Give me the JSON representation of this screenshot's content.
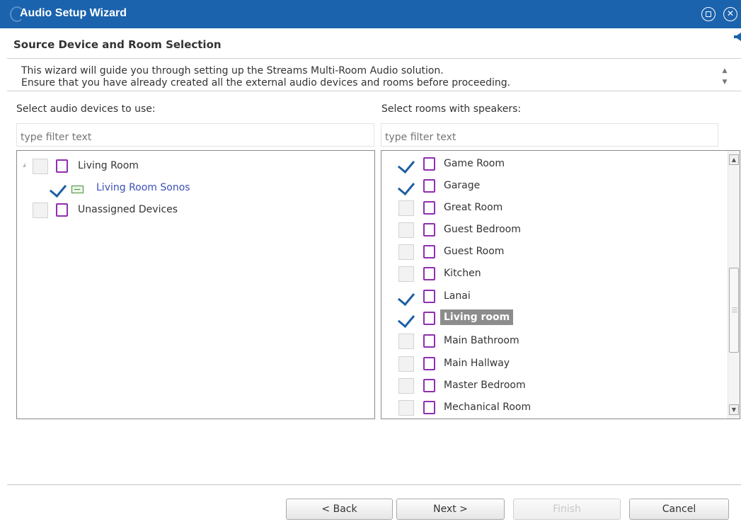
{
  "window": {
    "title": "Audio Setup Wizard",
    "restore_icon": "restore-icon",
    "close_icon": "close-icon"
  },
  "page": {
    "heading": "Source Device and Room Selection",
    "intro_lines": [
      "This wizard will guide you through setting up the Streams Multi-Room Audio solution.",
      "Ensure that you have already created all the external audio devices and rooms before proceeding."
    ]
  },
  "devices_panel": {
    "label": "Select audio devices to use:",
    "filter_placeholder": "type filter text",
    "items": [
      {
        "label": "Living Room",
        "checked": false,
        "type": "room",
        "expanded": true,
        "level": 0
      },
      {
        "label": "Living Room Sonos",
        "checked": true,
        "type": "device",
        "level": 1
      },
      {
        "label": "Unassigned Devices",
        "checked": false,
        "type": "room",
        "level": 0
      }
    ]
  },
  "rooms_panel": {
    "label": "Select rooms with speakers:",
    "filter_placeholder": "type filter text",
    "items": [
      {
        "label": "Game Room",
        "checked": true
      },
      {
        "label": "Garage",
        "checked": true
      },
      {
        "label": "Great Room",
        "checked": false
      },
      {
        "label": "Guest Bedroom",
        "checked": false
      },
      {
        "label": "Guest Room",
        "checked": false
      },
      {
        "label": "Kitchen",
        "checked": false
      },
      {
        "label": "Lanai",
        "checked": true
      },
      {
        "label": "Living room",
        "checked": true,
        "selected": true
      },
      {
        "label": "Main Bathroom",
        "checked": false
      },
      {
        "label": "Main Hallway",
        "checked": false
      },
      {
        "label": "Master Bedroom",
        "checked": false
      },
      {
        "label": "Mechanical Room",
        "checked": false
      }
    ]
  },
  "buttons": {
    "back": "< Back",
    "next": "Next >",
    "finish": "Finish",
    "cancel": "Cancel"
  },
  "colors": {
    "titlebar": "#1b63ad",
    "checkmark": "#1c5fa3",
    "room_icon": "#8f2fb0",
    "device_link": "#3b4fb8",
    "selection": "#8c8c8c"
  }
}
